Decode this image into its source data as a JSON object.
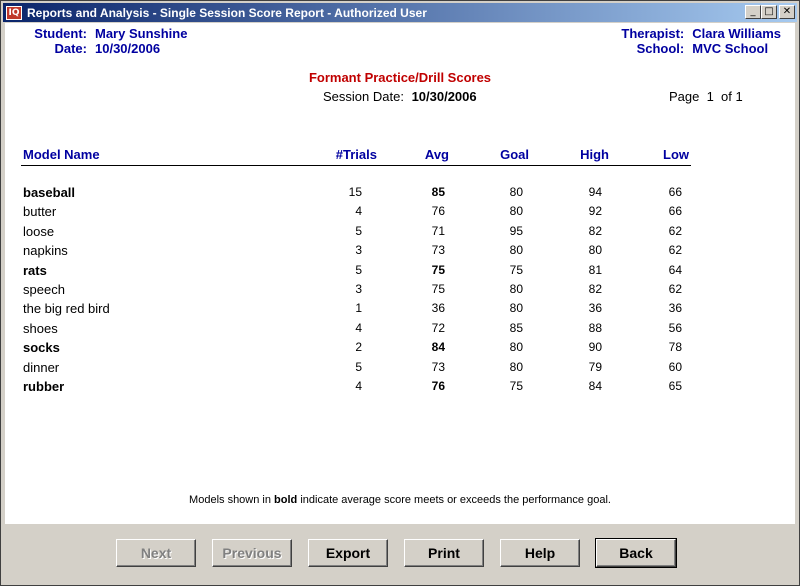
{
  "window": {
    "title": "Reports and Analysis - Single Session Score Report - Authorized User",
    "icon": "app-icon",
    "controls": [
      "minimize",
      "maximize",
      "close"
    ]
  },
  "header": {
    "student_label": "Student:",
    "student": "Mary Sunshine",
    "date_label": "Date:",
    "date": "10/30/2006",
    "therapist_label": "Therapist:",
    "therapist": "Clara Williams",
    "school_label": "School:",
    "school": "MVC School"
  },
  "report": {
    "title": "Formant Practice/Drill Scores",
    "session_date_label": "Session Date:",
    "session_date": "10/30/2006",
    "page_info": "Page  1  of 1"
  },
  "columns": {
    "model_name": "Model Name",
    "trials": "#Trials",
    "avg": "Avg",
    "goal": "Goal",
    "high": "High",
    "low": "Low"
  },
  "rows": [
    {
      "name": "baseball",
      "trials": "15",
      "avg": "85",
      "goal": "80",
      "high": "94",
      "low": "66",
      "bold": true
    },
    {
      "name": "butter",
      "trials": "4",
      "avg": "76",
      "goal": "80",
      "high": "92",
      "low": "66",
      "bold": false
    },
    {
      "name": "loose",
      "trials": "5",
      "avg": "71",
      "goal": "95",
      "high": "82",
      "low": "62",
      "bold": false
    },
    {
      "name": "napkins",
      "trials": "3",
      "avg": "73",
      "goal": "80",
      "high": "80",
      "low": "62",
      "bold": false
    },
    {
      "name": "rats",
      "trials": "5",
      "avg": "75",
      "goal": "75",
      "high": "81",
      "low": "64",
      "bold": true
    },
    {
      "name": "speech",
      "trials": "3",
      "avg": "75",
      "goal": "80",
      "high": "82",
      "low": "62",
      "bold": false
    },
    {
      "name": "the big red bird",
      "trials": "1",
      "avg": "36",
      "goal": "80",
      "high": "36",
      "low": "36",
      "bold": false
    },
    {
      "name": "shoes",
      "trials": "4",
      "avg": "72",
      "goal": "85",
      "high": "88",
      "low": "56",
      "bold": false
    },
    {
      "name": "socks",
      "trials": "2",
      "avg": "84",
      "goal": "80",
      "high": "90",
      "low": "78",
      "bold": true
    },
    {
      "name": "dinner",
      "trials": "5",
      "avg": "73",
      "goal": "80",
      "high": "79",
      "low": "60",
      "bold": false
    },
    {
      "name": "rubber",
      "trials": "4",
      "avg": "76",
      "goal": "75",
      "high": "84",
      "low": "65",
      "bold": true
    }
  ],
  "footnote": {
    "pre": "Models shown in ",
    "bold_word": "bold",
    "post": " indicate average score meets or exceeds the performance goal."
  },
  "buttons": {
    "next": "Next",
    "previous": "Previous",
    "export": "Export",
    "print": "Print",
    "help": "Help",
    "back": "Back"
  },
  "colors": {
    "header_text": "#0000a0",
    "title_text": "#c00000",
    "titlebar_start": "#0a246a",
    "titlebar_end": "#a6caf0"
  }
}
